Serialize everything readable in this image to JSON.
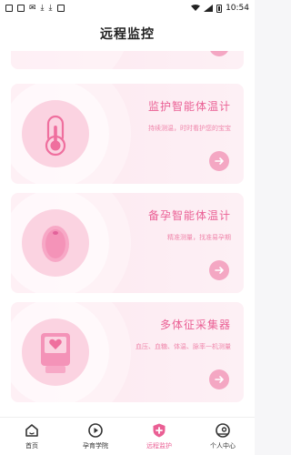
{
  "status_bar": {
    "time": "10:54"
  },
  "header": {
    "title": "远程监控"
  },
  "cards": [
    {
      "title": "监护智能体温计",
      "subtitle": "持续测温，时时看护您的宝宝",
      "icon": "thermometer-icon"
    },
    {
      "title": "备孕智能体温计",
      "subtitle": "精准测量，找准易孕期",
      "icon": "egg-thermometer-icon"
    },
    {
      "title": "多体征采集器",
      "subtitle": "血压、血糖、体温、脉率一机测量",
      "icon": "vital-device-icon"
    }
  ],
  "nav": {
    "items": [
      {
        "label": "首页",
        "icon": "home-icon"
      },
      {
        "label": "孕育学院",
        "icon": "play-icon"
      },
      {
        "label": "远程监护",
        "icon": "shield-plus-icon",
        "active": true
      },
      {
        "label": "个人中心",
        "icon": "user-icon"
      }
    ]
  },
  "colors": {
    "accent": "#ea5f94",
    "card_bg": "#fde8f0"
  }
}
